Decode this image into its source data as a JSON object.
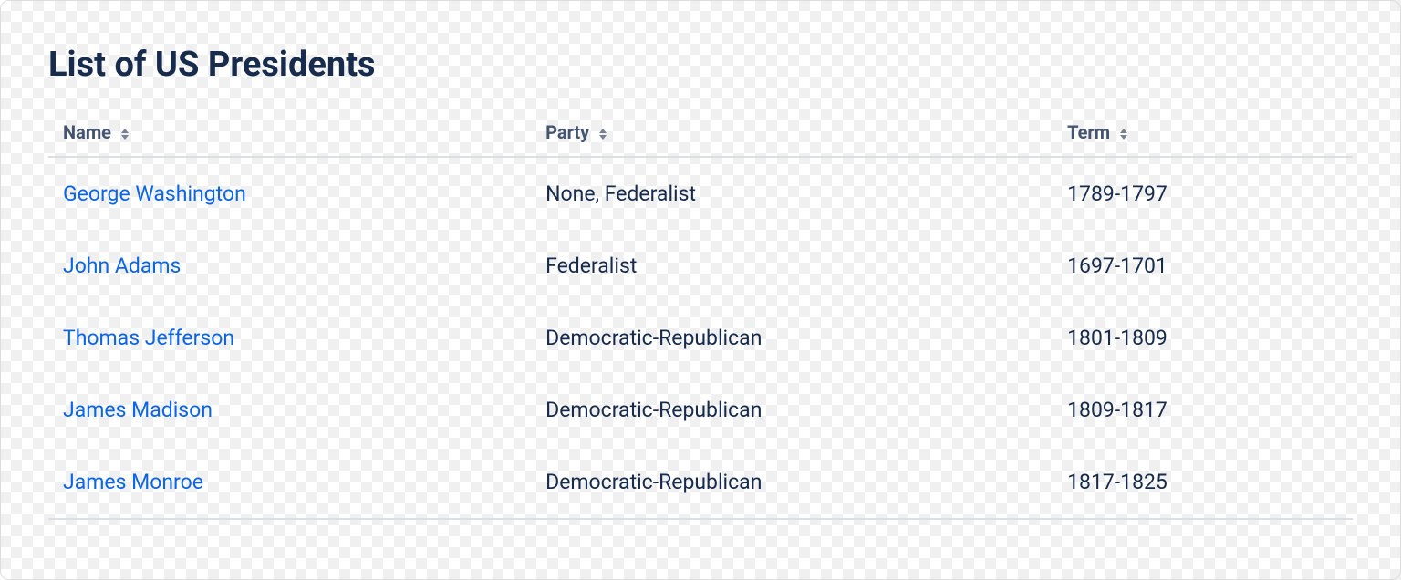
{
  "title": "List of US Presidents",
  "columns": {
    "name": "Name",
    "party": "Party",
    "term": "Term"
  },
  "rows": [
    {
      "name": "George Washington",
      "party": "None, Federalist",
      "term": "1789-1797"
    },
    {
      "name": "John Adams",
      "party": "Federalist",
      "term": "1697-1701"
    },
    {
      "name": "Thomas Jefferson",
      "party": "Democratic-Republican",
      "term": "1801-1809"
    },
    {
      "name": "James Madison",
      "party": "Democratic-Republican",
      "term": "1809-1817"
    },
    {
      "name": "James Monroe",
      "party": "Democratic-Republican",
      "term": "1817-1825"
    }
  ]
}
